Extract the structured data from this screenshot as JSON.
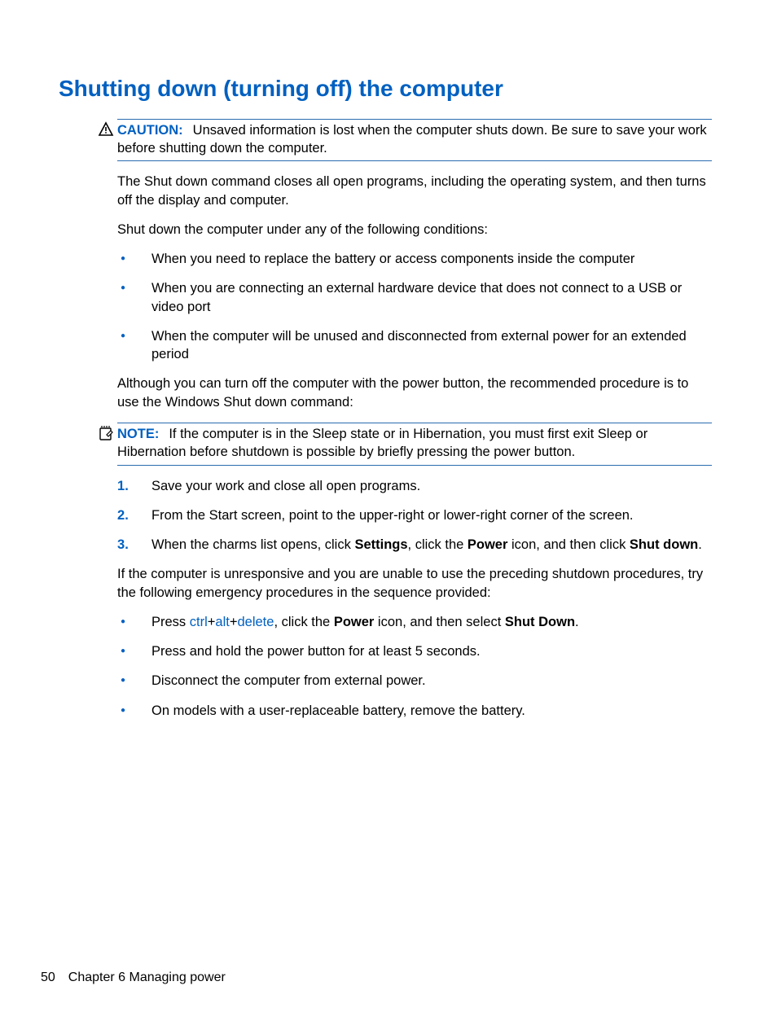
{
  "title": "Shutting down (turning off) the computer",
  "caution": {
    "label": "CAUTION:",
    "text": "Unsaved information is lost when the computer shuts down. Be sure to save your work before shutting down the computer."
  },
  "intro1": "The Shut down command closes all open programs, including the operating system, and then turns off the display and computer.",
  "intro2": "Shut down the computer under any of the following conditions:",
  "conditions": [
    "When you need to replace the battery or access components inside the computer",
    "When you are connecting an external hardware device that does not connect to a USB or video port",
    "When the computer will be unused and disconnected from external power for an extended period"
  ],
  "para_after_conditions": "Although you can turn off the computer with the power button, the recommended procedure is to use the Windows Shut down command:",
  "note": {
    "label": "NOTE:",
    "text": "If the computer is in the Sleep state or in Hibernation, you must first exit Sleep or Hibernation before shutdown is possible by briefly pressing the power button."
  },
  "steps": {
    "s1": "Save your work and close all open programs.",
    "s2": "From the Start screen, point to the upper-right or lower-right corner of the screen.",
    "s3_a": "When the charms list opens, click ",
    "s3_b": "Settings",
    "s3_c": ", click the ",
    "s3_d": "Power",
    "s3_e": " icon, and then click ",
    "s3_f": "Shut down",
    "s3_g": "."
  },
  "unresponsive": "If the computer is unresponsive and you are unable to use the preceding shutdown procedures, try the following emergency procedures in the sequence provided:",
  "emergency": {
    "e1_a": "Press ",
    "e1_ctrl": "ctrl",
    "e1_plus1": "+",
    "e1_alt": "alt",
    "e1_plus2": "+",
    "e1_del": "delete",
    "e1_b": ", click the ",
    "e1_c": "Power",
    "e1_d": " icon, and then select ",
    "e1_e": "Shut Down",
    "e1_f": ".",
    "e2": "Press and hold the power button for at least 5 seconds.",
    "e3": "Disconnect the computer from external power.",
    "e4": "On models with a user-replaceable battery, remove the battery."
  },
  "footer": {
    "page": "50",
    "chapter": "Chapter 6   Managing power"
  }
}
